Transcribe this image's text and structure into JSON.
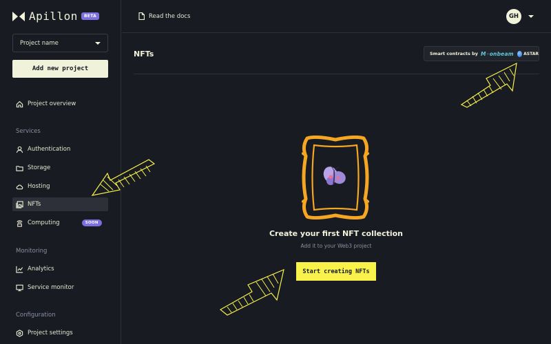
{
  "app": {
    "name": "Apillon",
    "beta_badge": "BETA"
  },
  "sidebar": {
    "project_select": {
      "value": "Project name"
    },
    "add_project_label": "Add new project",
    "overview_label": "Project overview",
    "sections": [
      {
        "label": "Services",
        "items": [
          {
            "label": "Authentication",
            "icon": "user-icon"
          },
          {
            "label": "Storage",
            "icon": "folder-icon"
          },
          {
            "label": "Hosting",
            "icon": "cloud-icon"
          },
          {
            "label": "NFTs",
            "icon": "image-icon",
            "active": true
          },
          {
            "label": "Computing",
            "icon": "computing-icon",
            "badge": "SOON"
          }
        ]
      },
      {
        "label": "Monitoring",
        "items": [
          {
            "label": "Analytics",
            "icon": "chart-line-icon"
          },
          {
            "label": "Service monitor",
            "icon": "monitor-icon"
          }
        ]
      },
      {
        "label": "Configuration",
        "items": [
          {
            "label": "Project settings",
            "icon": "settings-icon"
          }
        ]
      }
    ]
  },
  "topbar": {
    "docs_label": "Read the docs",
    "avatar_initials": "GH"
  },
  "main": {
    "title": "NFTs",
    "contracts": {
      "label": "Smart contracts by",
      "partner_1": "M◦onbeam",
      "partner_2": "ASTAR"
    },
    "empty_state": {
      "title": "Create your first NFT collection",
      "subtitle": "Add it to your Web3 project",
      "button_label": "Start creating NFTs"
    }
  },
  "colors": {
    "background": "#191b22",
    "text": "#f0f2da",
    "accent_yellow": "#f8f24b",
    "accent_purple": "#7d6fe0",
    "frame_orange": "#f5a623",
    "muted": "#8b8fa3"
  }
}
